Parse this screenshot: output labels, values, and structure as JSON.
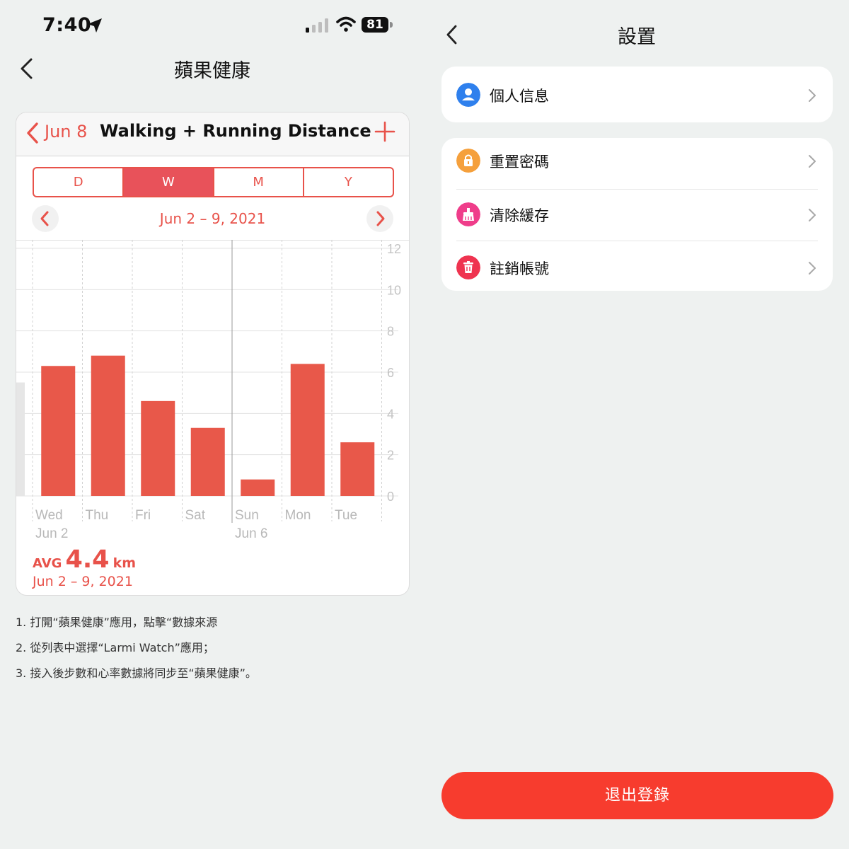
{
  "status_bar": {
    "time": "7:40",
    "battery": "81"
  },
  "left_screen": {
    "title": "蘋果健康",
    "card": {
      "header_date": "Jun 8",
      "header_title": "Walking + Running Distance",
      "segments": [
        {
          "label": "D",
          "active": false
        },
        {
          "label": "W",
          "active": true
        },
        {
          "label": "M",
          "active": false
        },
        {
          "label": "Y",
          "active": false
        }
      ],
      "range_label": "Jun 2 – 9, 2021",
      "avg_label": "AVG",
      "avg_value": "4.4",
      "avg_unit": "km",
      "avg_range": "Jun 2 – 9, 2021"
    },
    "instructions": [
      "1. 打開“蘋果健康”應用，點擊“數據來源",
      "2. 從列表中選擇“Larmi Watch”應用；",
      "3. 接入後步數和心率數據將同步至“蘋果健康”。"
    ]
  },
  "chart_data": {
    "type": "bar",
    "categories": [
      "Wed",
      "Thu",
      "Fri",
      "Sat",
      "Sun",
      "Mon",
      "Tue"
    ],
    "date_labels": [
      "Jun 2",
      "",
      "",
      "",
      "Jun 6",
      "",
      ""
    ],
    "values": [
      6.3,
      6.8,
      4.6,
      3.3,
      0.8,
      6.4,
      2.6
    ],
    "previous_partial_value": 5.5,
    "y_ticks": [
      0,
      2,
      4,
      6,
      8,
      10,
      12
    ],
    "ylim": [
      0,
      12
    ],
    "bar_color": "#e8584a",
    "grid": true
  },
  "right_screen": {
    "title": "設置",
    "items": [
      {
        "label": "個人信息",
        "icon": "user-icon",
        "color": "#2f80ed"
      },
      {
        "label": "重置密碼",
        "icon": "lock-icon",
        "color": "#f5a03c"
      },
      {
        "label": "清除緩存",
        "icon": "broom-icon",
        "color": "#ef3d8a"
      },
      {
        "label": "註銷帳號",
        "icon": "trash-icon",
        "color": "#ef3450"
      }
    ],
    "logout_label": "退出登錄"
  }
}
